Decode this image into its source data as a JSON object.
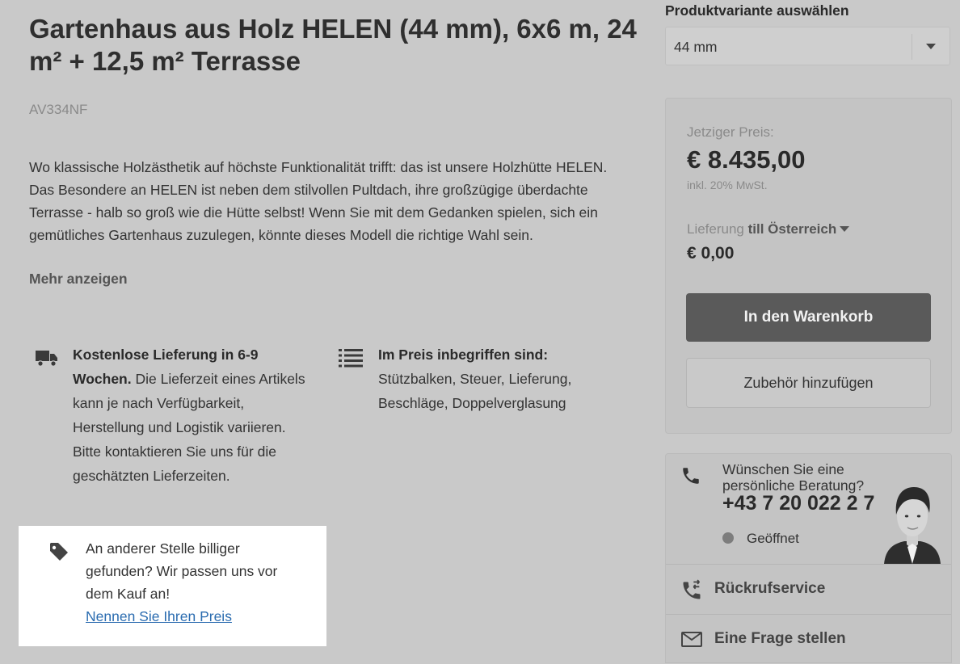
{
  "product": {
    "title": "Gartenhaus aus Holz HELEN (44 mm), 6x6 m, 24 m² + 12,5 m² Terrasse",
    "sku": "AV334NF",
    "description": "Wo klassische Holzästhetik auf höchste Funktionalität trifft: das ist unsere Holzhütte HELEN. Das Besondere an HELEN ist neben dem stilvollen Pultdach, ihre großzügige überdachte Terrasse - halb so groß wie die Hütte selbst! Wenn Sie mit dem Gedanken spielen, sich ein gemütliches Gartenhaus zuzulegen, könnte dieses Modell die richtige Wahl sein.",
    "more_label": "Mehr anzeigen"
  },
  "features": {
    "delivery": {
      "icon": "truck-icon",
      "bold": "Kostenlose Lieferung in 6-9 Wochen.",
      "text": " Die Lieferzeit eines Artikels kann je nach Verfügbarkeit, Herstellung und Logistik variieren. Bitte kontaktieren Sie uns für die geschätzten Lieferzeiten."
    },
    "included": {
      "icon": "list-icon",
      "bold": "Im Preis inbegriffen sind:",
      "text": "Stützbalken, Steuer, Lieferung, Beschläge, Doppelverglasung"
    }
  },
  "price_match": {
    "icon": "price-tag-icon",
    "text": "An anderer Stelle billiger gefunden? Wir passen uns vor dem Kauf an!",
    "link": "Nennen Sie Ihren Preis"
  },
  "variant": {
    "label": "Produktvariante auswählen",
    "selected": "44 mm"
  },
  "pricing": {
    "current_label": "Jetziger Preis:",
    "price": "€ 8.435,00",
    "vat": "inkl. 20% MwSt.",
    "delivery_prefix": "Lieferung",
    "delivery_country": "till Österreich",
    "delivery_price": "€ 0,00",
    "cart_button": "In den Warenkorb",
    "accessories_button": "Zubehör hinzufügen"
  },
  "contact": {
    "question": "Wünschen Sie eine persönliche Beratung?",
    "phone": "+43 7 20 022 2 7",
    "status": "Geöffnet",
    "callback": "Rückrufservice",
    "ask": "Eine Frage stellen"
  },
  "colors": {
    "background": "#c9c9c9",
    "cart_button": "#5a5a5a",
    "link": "#2b6cb0"
  }
}
